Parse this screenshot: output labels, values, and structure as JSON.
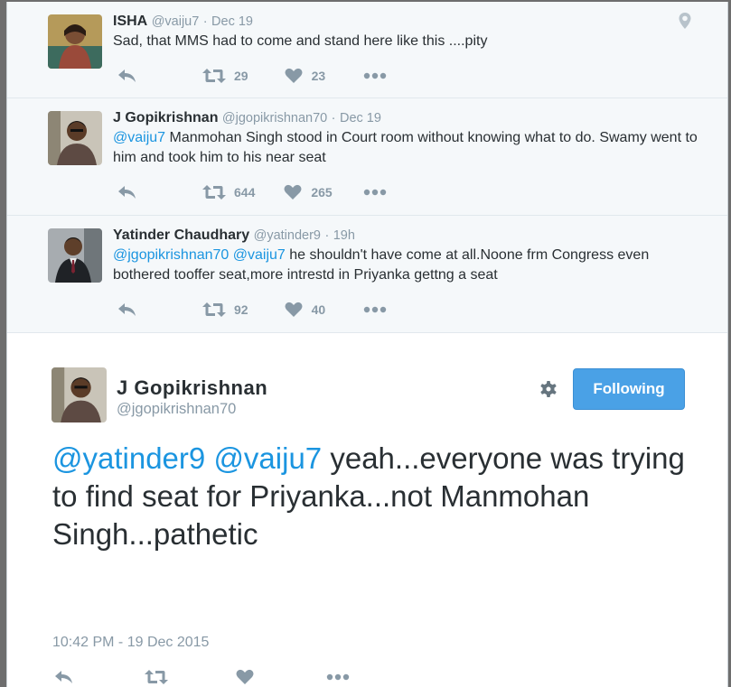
{
  "replies": [
    {
      "name": "ISHA",
      "handle": "@vaiju7",
      "date": "Dec 19",
      "parts": [
        {
          "t": "Sad, that MMS had to come and stand here like this ....pity",
          "m": false
        }
      ],
      "retweets": "29",
      "likes": "23",
      "has_location": true
    },
    {
      "name": "J Gopikrishnan",
      "handle": "@jgopikrishnan70",
      "date": "Dec 19",
      "parts": [
        {
          "t": "@vaiju7",
          "m": true
        },
        {
          "t": " Manmohan Singh stood in Court room without knowing what to do. Swamy went to him and took him to his near seat",
          "m": false
        }
      ],
      "retweets": "644",
      "likes": "265",
      "has_location": false
    },
    {
      "name": "Yatinder Chaudhary",
      "handle": "@yatinder9",
      "date": "19h",
      "parts": [
        {
          "t": "@jgopikrishnan70",
          "m": true
        },
        {
          "t": " ",
          "m": false
        },
        {
          "t": "@vaiju7",
          "m": true
        },
        {
          "t": " he shouldn't have come at all.Noone frm Congress even bothered tooffer seat,more intrestd in Priyanka gettng a seat",
          "m": false
        }
      ],
      "retweets": "92",
      "likes": "40",
      "has_location": false
    }
  ],
  "main_tweet": {
    "name": "J Gopikrishnan",
    "handle": "@jgopikrishnan70",
    "follow_label": "Following",
    "parts": [
      {
        "t": "@yatinder9",
        "m": true
      },
      {
        "t": " ",
        "m": false
      },
      {
        "t": "@vaiju7",
        "m": true
      },
      {
        "t": " yeah...everyone was trying to find seat for Priyanka...not Manmohan Singh...pathetic",
        "m": false
      }
    ],
    "timestamp": "10:42 PM - 19 Dec 2015"
  },
  "icons": {
    "reply": "reply-icon",
    "retweet": "retweet-icon",
    "like": "heart-icon",
    "more": "more-icon",
    "location": "location-pin-icon",
    "settings": "gear-icon"
  },
  "colors": {
    "link": "#1b95e0",
    "follow_button": "#4aa1e6",
    "muted": "#8899a6",
    "text": "#292f33"
  }
}
